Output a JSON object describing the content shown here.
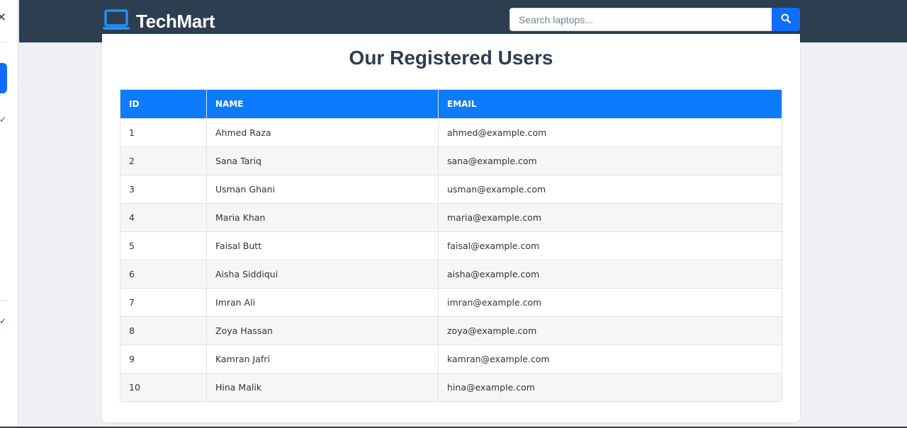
{
  "brand": {
    "name": "TechMart",
    "icon": "laptop-icon",
    "icon_color": "#1e90ff"
  },
  "search": {
    "placeholder": "Search laptops...",
    "button_icon": "search-icon"
  },
  "page": {
    "title": "Our Registered Users"
  },
  "table": {
    "headers": [
      "ID",
      "NAME",
      "EMAIL"
    ],
    "rows": [
      {
        "id": "1",
        "name": "Ahmed Raza",
        "email": "ahmed@example.com"
      },
      {
        "id": "2",
        "name": "Sana Tariq",
        "email": "sana@example.com"
      },
      {
        "id": "3",
        "name": "Usman Ghani",
        "email": "usman@example.com"
      },
      {
        "id": "4",
        "name": "Maria Khan",
        "email": "maria@example.com"
      },
      {
        "id": "5",
        "name": "Faisal Butt",
        "email": "faisal@example.com"
      },
      {
        "id": "6",
        "name": "Aisha Siddiqui",
        "email": "aisha@example.com"
      },
      {
        "id": "7",
        "name": "Imran Ali",
        "email": "imran@example.com"
      },
      {
        "id": "8",
        "name": "Zoya Hassan",
        "email": "zoya@example.com"
      },
      {
        "id": "9",
        "name": "Kamran Jafri",
        "email": "kamran@example.com"
      },
      {
        "id": "10",
        "name": "Hina Malik",
        "email": "hina@example.com"
      }
    ]
  },
  "side_panel": {
    "close_icon": "close-icon",
    "check_icon": "check-icon"
  },
  "colors": {
    "navbar": "#2c3e50",
    "accent": "#0d6efd",
    "table_header": "#0d7bfd"
  }
}
